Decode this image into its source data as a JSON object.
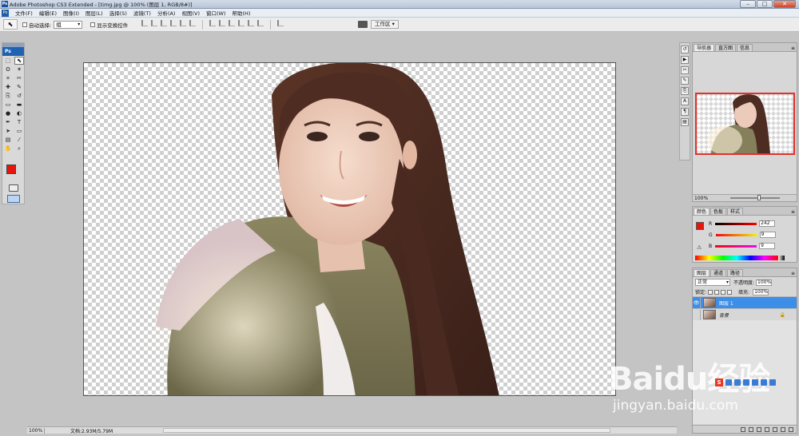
{
  "window": {
    "title": "Adobe Photoshop CS3 Extended - [timg.jpg @ 100% (图层 1, RGB/8#)]",
    "app_icon": "Ps"
  },
  "menu": {
    "items": [
      "文件(F)",
      "编辑(E)",
      "图像(I)",
      "图层(L)",
      "选择(S)",
      "滤镜(T)",
      "分析(A)",
      "视图(V)",
      "窗口(W)",
      "帮助(H)"
    ]
  },
  "options": {
    "auto_select_label": "自动选择:",
    "auto_select_value": "组",
    "show_transform_label": "显示变换控件",
    "workspace_label": "工作区 ▾"
  },
  "toolbox": {
    "logo": "Ps",
    "tool_icons": [
      "marquee-icon",
      "move-icon",
      "lasso-icon",
      "magic-wand-icon",
      "crop-icon",
      "slice-icon",
      "healing-icon",
      "brush-icon",
      "stamp-icon",
      "history-brush-icon",
      "eraser-icon",
      "gradient-icon",
      "blur-icon",
      "dodge-icon",
      "pen-icon",
      "type-icon",
      "path-select-icon",
      "shape-icon",
      "notes-icon",
      "eyedropper-icon",
      "hand-icon",
      "zoom-icon"
    ],
    "tool_glyphs": [
      "⬚",
      "⬉",
      "ʘ",
      "✶",
      "⌗",
      "✂",
      "✚",
      "✎",
      "⎘",
      "↺",
      "▭",
      "▬",
      "●",
      "◐",
      "✒",
      "T",
      "➤",
      "▭",
      "▤",
      "⁄",
      "✋",
      "⌕"
    ],
    "fg_color": "#e8150e",
    "bg_color": "#ffffff"
  },
  "statusbar": {
    "zoom": "100%",
    "doc_info": "文档:2.93M/5.79M"
  },
  "navigator": {
    "tabs": [
      "导航器",
      "直方图",
      "信息"
    ],
    "zoom": "100%"
  },
  "color_panel": {
    "tabs": [
      "颜色",
      "色板",
      "样式"
    ],
    "r_label": "R",
    "r_value": "242",
    "g_label": "G",
    "g_value": "9",
    "b_label": "B",
    "b_value": "9"
  },
  "layers_panel": {
    "tabs": [
      "图层",
      "通道",
      "路径"
    ],
    "blend_mode": "正常",
    "opacity_label": "不透明度:",
    "opacity_value": "100%",
    "lock_label": "锁定:",
    "fill_label": "填充:",
    "fill_value": "100%",
    "layers": [
      {
        "name": "图层 1",
        "visible": true,
        "selected": true
      },
      {
        "name": "背景",
        "visible": false,
        "selected": false,
        "locked": true
      }
    ]
  },
  "watermark": {
    "brand": "Baidu经验",
    "url": "jingyan.baidu.com"
  }
}
